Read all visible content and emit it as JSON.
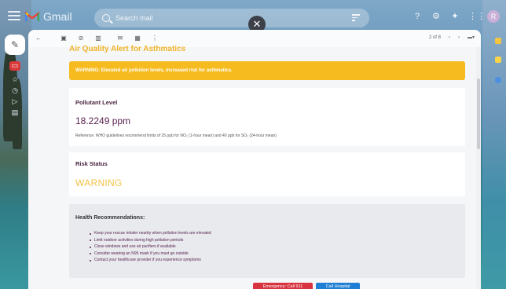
{
  "app": {
    "name": "Gmail",
    "search_placeholder": "Search mail",
    "close_glyph": "✕",
    "avatar_initial": "R"
  },
  "toolbar": {
    "pagination": "2 of 8"
  },
  "email": {
    "title": "Air Quality Alert for Asthmatics",
    "warning_banner": "WARNING: Elevated air pollution levels, increased risk for asthmatics.",
    "pollutant_label": "Pollutant Level",
    "pollutant_value": "18.2249 ppm",
    "reference": "Reference: WHO guidelines recommend limits of 25 ppb for NO₂ (1-hour mean) and 40 ppb for SO₂ (24-hour mean)",
    "risk_label": "Risk Status",
    "risk_value": "WARNING",
    "recommendations_title": "Health Recommendations:",
    "recommendations": [
      "Keep your rescue inhaler nearby when pollution levels are elevated",
      "Limit outdoor activities during high pollution periods",
      "Close windows and use air purifiers if available",
      "Consider wearing an N95 mask if you must go outside",
      "Contact your healthcare provider if you experience symptoms"
    ],
    "emergency_button": "Emergency: Call 911",
    "hospital_button": "Call Hospital"
  },
  "colors": {
    "warning": "#f6bb1f",
    "emergency": "#d8343f",
    "hospital": "#1e7fd4",
    "accent_text": "#5a2350"
  }
}
